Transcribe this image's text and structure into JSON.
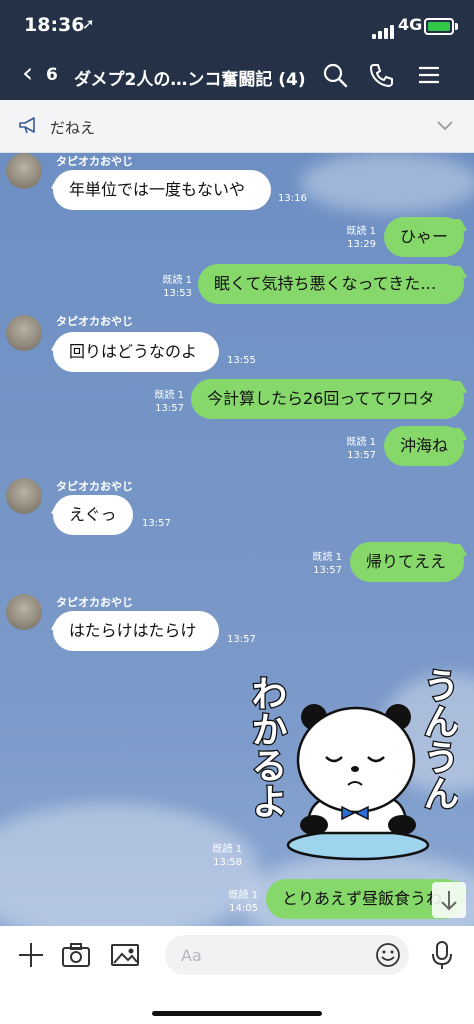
{
  "status": {
    "time": "18:36",
    "network": "4G"
  },
  "header": {
    "back_count": "6",
    "title": "ダメプ2人の…ンコ奮闘記 (4)"
  },
  "announcement": {
    "text": "だねえ"
  },
  "messages": [
    {
      "sender": "タピオカおやじ",
      "text": "年単位では一度もないや",
      "time": "13:16"
    },
    {
      "text": "ひゃー",
      "read": "既読 1",
      "time": "13:29"
    },
    {
      "text": "眠くて気持ち悪くなってきた…",
      "read": "既読 1",
      "time": "13:53"
    },
    {
      "sender": "タピオカおやじ",
      "text": "回りはどうなのよ",
      "time": "13:55"
    },
    {
      "text": "今計算したら26回っててワロタ",
      "read": "既読 1",
      "time": "13:57"
    },
    {
      "text": "沖海ね",
      "read": "既読 1",
      "time": "13:57"
    },
    {
      "sender": "タピオカおやじ",
      "text": "えぐっ",
      "time": "13:57"
    },
    {
      "text": "帰りてええ",
      "read": "既読 1",
      "time": "13:57"
    },
    {
      "sender": "タピオカおやじ",
      "text": "はたらけはたらけ",
      "time": "13:57"
    },
    {
      "sticker": "panda-nodding-sticker",
      "sticker_text_left": "わかるよ",
      "sticker_text_right": "うんうん",
      "read": "既読 1",
      "time": "13:58"
    },
    {
      "text": "とりあえず昼飯食うわ",
      "read": "既読 1",
      "time": "14:05"
    }
  ],
  "input": {
    "placeholder": "Aa"
  },
  "icons": [
    "location-arrow-icon",
    "signal-icon",
    "battery-icon",
    "back-chevron-icon",
    "search-icon",
    "phone-icon",
    "menu-icon",
    "megaphone-icon",
    "chevron-down-icon",
    "scroll-down-icon",
    "plus-icon",
    "camera-icon",
    "image-icon",
    "emoji-icon",
    "mic-icon"
  ],
  "colors": {
    "header": "#243147",
    "outgoing_bubble": "#86d86b",
    "incoming_bubble": "#ffffff",
    "chat_background": "#7595c6"
  }
}
